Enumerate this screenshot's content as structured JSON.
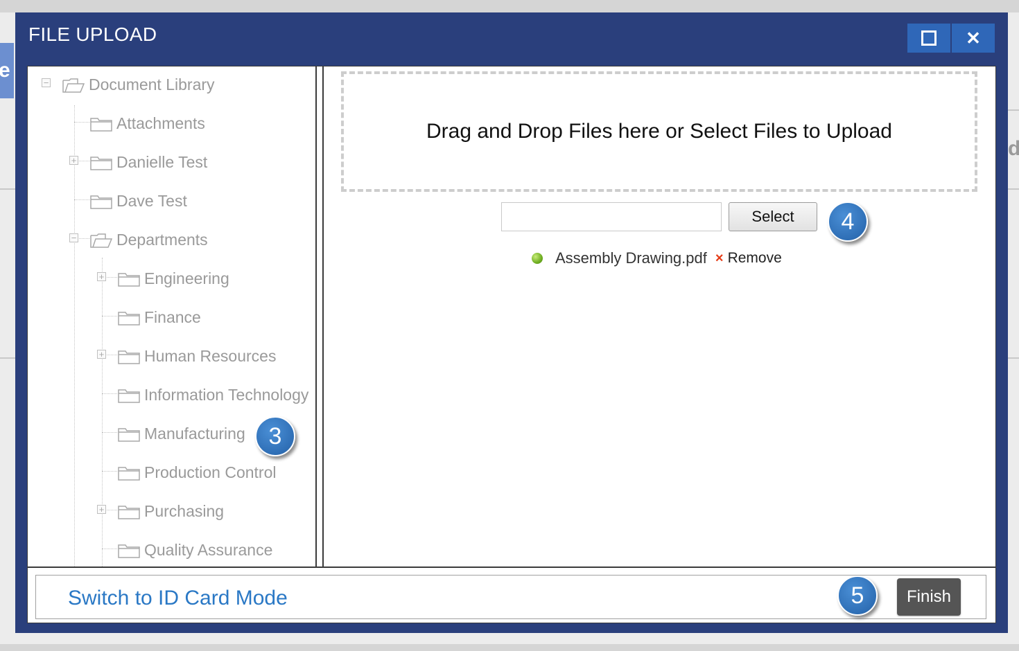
{
  "dialog": {
    "title": "FILE UPLOAD",
    "maximize_icon": "maximize-icon",
    "close_icon": "close-icon",
    "close_glyph": "✕"
  },
  "background": {
    "left_fragment": "e",
    "right_fragment": "d"
  },
  "tree": {
    "root": {
      "label": "Document Library",
      "expanded": true
    },
    "items": [
      {
        "label": "Attachments",
        "toggle": ""
      },
      {
        "label": "Danielle Test",
        "toggle": "+"
      },
      {
        "label": "Dave Test",
        "toggle": ""
      },
      {
        "label": "Departments",
        "toggle": "−",
        "expanded": true
      },
      {
        "label": "Engineering",
        "toggle": "+"
      },
      {
        "label": "Finance",
        "toggle": ""
      },
      {
        "label": "Human Resources",
        "toggle": "+"
      },
      {
        "label": "Information Technology",
        "toggle": ""
      },
      {
        "label": "Manufacturing",
        "toggle": ""
      },
      {
        "label": "Production Control",
        "toggle": ""
      },
      {
        "label": "Purchasing",
        "toggle": "+"
      },
      {
        "label": "Quality Assurance",
        "toggle": ""
      }
    ]
  },
  "upload": {
    "dropzone_text": "Drag and Drop Files here or Select Files to Upload",
    "file_input_value": "",
    "select_label": "Select",
    "file": {
      "name": "Assembly Drawing.pdf",
      "status_color": "#7ab82a",
      "remove_glyph": "×",
      "remove_label": "Remove"
    }
  },
  "footer": {
    "switch_link": "Switch to ID Card Mode",
    "finish_label": "Finish"
  },
  "badges": {
    "step3": "3",
    "step4": "4",
    "step5": "5"
  },
  "colors": {
    "dialog_frame": "#2a3f7c",
    "window_button": "#2f67b8",
    "link": "#2a78c5",
    "finish_button": "#555555",
    "badge": "#2f6fb6"
  }
}
